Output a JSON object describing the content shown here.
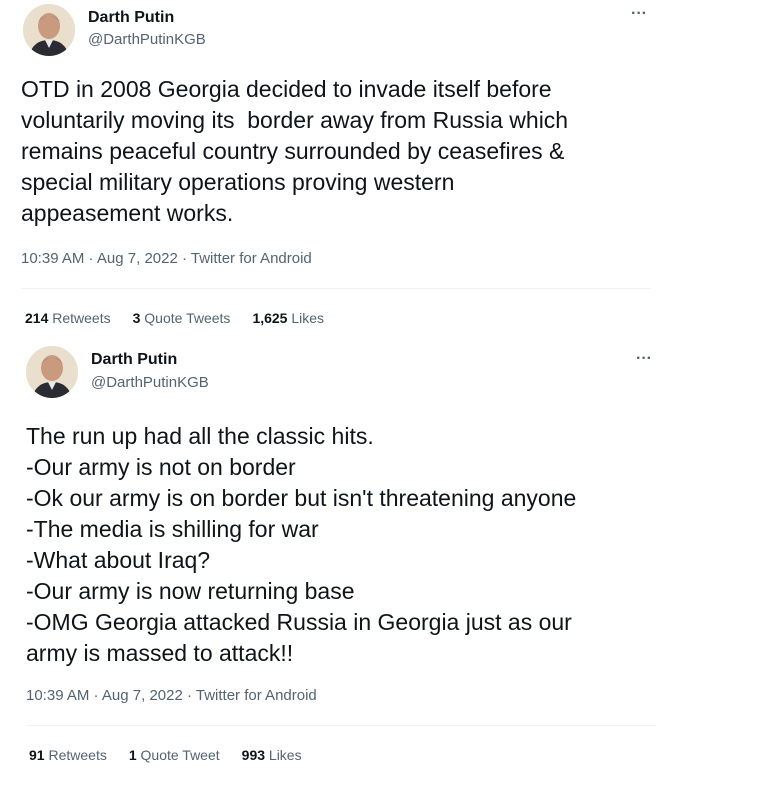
{
  "tweets": [
    {
      "name": "Darth Putin",
      "handle": "@DarthPutinKGB",
      "more": "···",
      "text": "OTD in 2008 Georgia decided to invade itself before\nvoluntarily moving its  border away from Russia which\nremains peaceful country surrounded by ceasefires &\nspecial military operations proving western\nappeasement works.",
      "time": "10:39 AM",
      "date": "Aug 7, 2022",
      "source": "Twitter for Android",
      "retweets_count": "214",
      "retweets_label": "Retweets",
      "quotes_count": "3",
      "quotes_label": "Quote Tweets",
      "likes_count": "1,625",
      "likes_label": "Likes"
    },
    {
      "name": "Darth Putin",
      "handle": "@DarthPutinKGB",
      "more": "···",
      "text": "The run up had all the classic hits.\n-Our army is not on border\n-Ok our army is on border but isn't threatening anyone\n-The media is shilling for war\n-What about Iraq?\n-Our army is now returning base\n-OMG Georgia attacked Russia in Georgia just as our\narmy is massed to attack!!",
      "time": "10:39 AM",
      "date": "Aug 7, 2022",
      "source": "Twitter for Android",
      "retweets_count": "91",
      "retweets_label": "Retweets",
      "quotes_count": "1",
      "quotes_label": "Quote Tweet",
      "likes_count": "993",
      "likes_label": "Likes"
    }
  ],
  "separator": " · ",
  "icons": {
    "more": "more-horizontal-icon",
    "avatar": "profile-avatar"
  }
}
